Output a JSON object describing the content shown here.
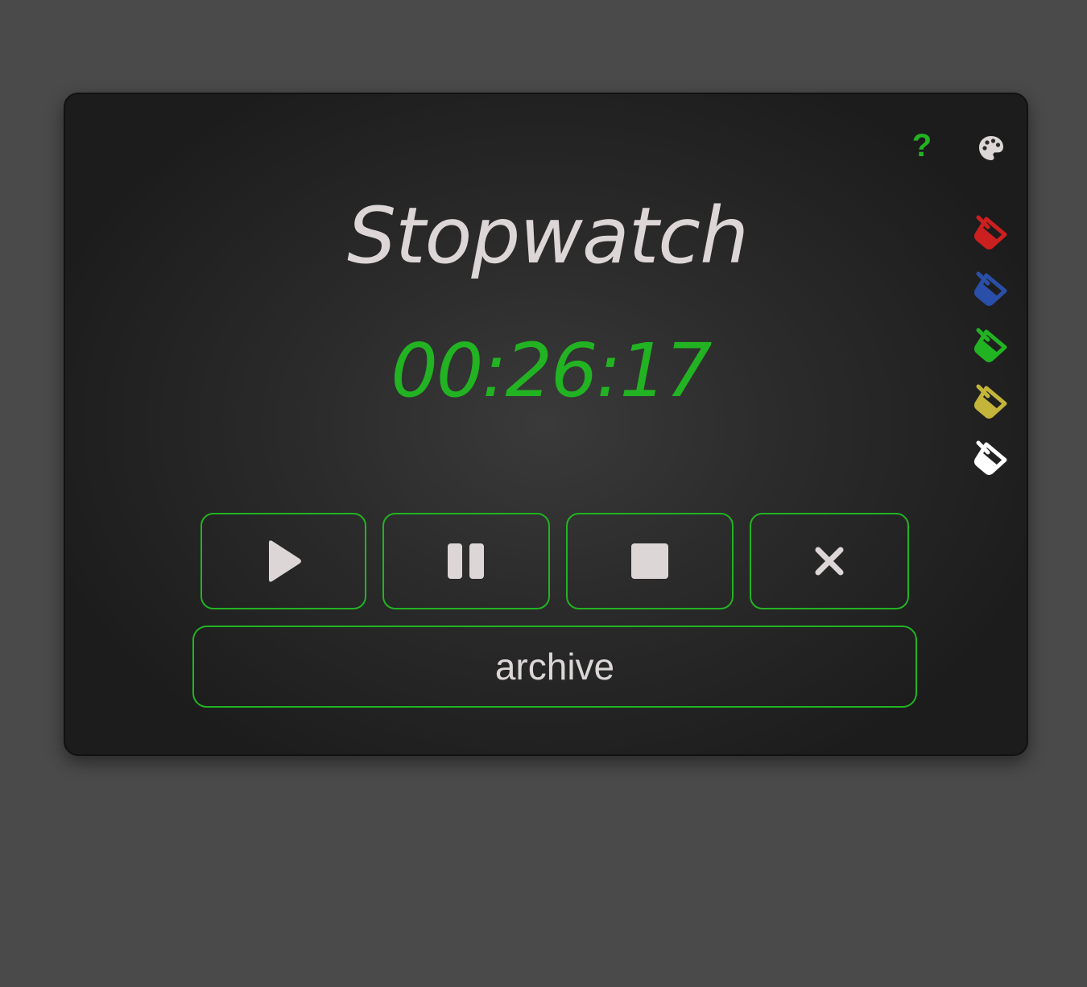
{
  "app": {
    "title": "Stopwatch",
    "time": "00:26:17"
  },
  "toolbar": {
    "help_label": "?",
    "palette_icon": "palette-icon"
  },
  "themes": [
    {
      "name": "red",
      "color": "#cc1f1f"
    },
    {
      "name": "blue",
      "color": "#2a4fa8"
    },
    {
      "name": "green",
      "color": "#22b322"
    },
    {
      "name": "yellow",
      "color": "#c4b43a"
    },
    {
      "name": "white",
      "color": "#ffffff"
    }
  ],
  "controls": {
    "play_icon": "play-icon",
    "pause_icon": "pause-icon",
    "stop_icon": "stop-icon",
    "reset_icon": "close-icon",
    "archive_label": "archive"
  },
  "colors": {
    "accent": "#22b322",
    "text": "#dcd6d6",
    "page_background": "#4a4a4a"
  }
}
